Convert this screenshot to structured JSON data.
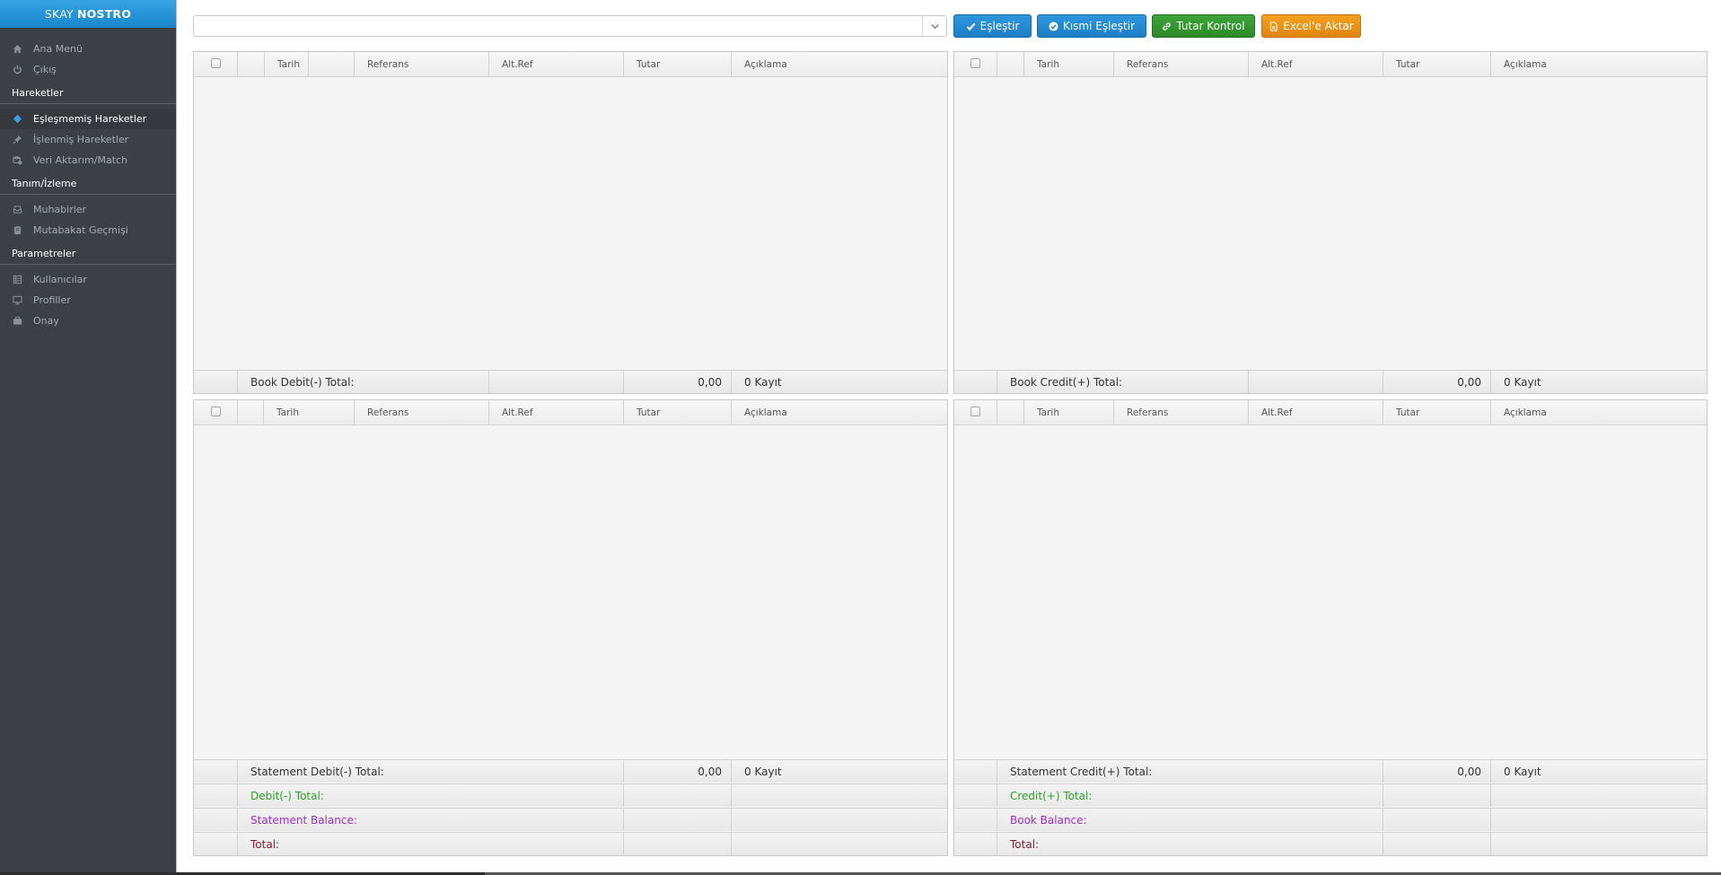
{
  "app": {
    "brand_light": "SKAY ",
    "brand_bold": "NOSTRO"
  },
  "sidebar": {
    "top_items": [
      {
        "label": "Ana Menü",
        "icon": "home-icon"
      },
      {
        "label": "Çıkış",
        "icon": "power-icon"
      }
    ],
    "sections": [
      {
        "title": "Hareketler",
        "items": [
          {
            "label": "Eşleşmemiş Hareketler",
            "icon": "diamond-icon",
            "active": true
          },
          {
            "label": "İşlenmiş Hareketler",
            "icon": "pin-icon"
          },
          {
            "label": "Veri Aktarım/Match",
            "icon": "database-icon"
          }
        ]
      },
      {
        "title": "Tanım/İzleme",
        "items": [
          {
            "label": "Muhabirler",
            "icon": "inbox-icon"
          },
          {
            "label": "Mutabakat Geçmişi",
            "icon": "book-icon"
          }
        ]
      },
      {
        "title": "Parametreler",
        "items": [
          {
            "label": "Kullanıcılar",
            "icon": "list-icon"
          },
          {
            "label": "Profiller",
            "icon": "monitor-icon"
          },
          {
            "label": "Onay",
            "icon": "briefcase-icon"
          }
        ]
      }
    ]
  },
  "toolbar": {
    "filter_value": "",
    "buttons": {
      "match": "Eşleştir",
      "partial_match": "Kısmi Eşleştir",
      "amount_check": "Tutar Kontrol",
      "export_excel": "Excel'e Aktar"
    }
  },
  "columns": [
    "Tarih",
    "Referans",
    "Alt.Ref",
    "Tutar",
    "Açıklama"
  ],
  "grids": {
    "book_debit": {
      "total_label": "Book Debit(-) Total:",
      "total": "0,00",
      "count": "0 Kayıt"
    },
    "book_credit": {
      "total_label": "Book Credit(+) Total:",
      "total": "0,00",
      "count": "0 Kayıt"
    },
    "statement_debit": {
      "total_label": "Statement Debit(-) Total:",
      "total": "0,00",
      "count": "0 Kayıt",
      "debit_total_label": "Debit(-) Total:",
      "balance_label": "Statement Balance:",
      "grand_total_label": "Total:"
    },
    "statement_credit": {
      "total_label": "Statement Credit(+) Total:",
      "total": "0,00",
      "count": "0 Kayıt",
      "credit_total_label": "Credit(+) Total:",
      "balance_label": "Book Balance:",
      "grand_total_label": "Total:"
    }
  },
  "colors": {
    "brand": "#1b86cc",
    "sidebar_bg": "#3d4145",
    "green_text": "#2e9f2a",
    "purple_text": "#9b2fc8",
    "maroon_text": "#8e1b2a"
  }
}
